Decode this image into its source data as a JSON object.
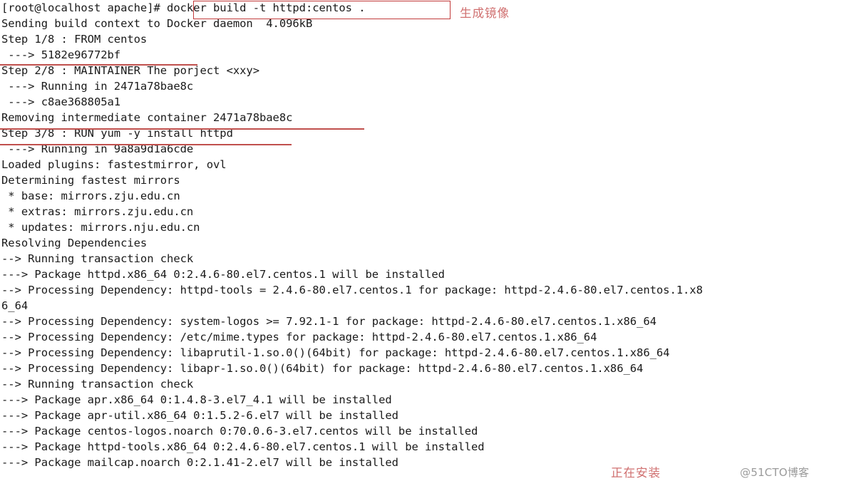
{
  "terminal": {
    "shell_prompt": "[root@localhost apache]# ",
    "typed_command": "docker build -t httpd:centos .",
    "lines": [
      "[root@localhost apache]# docker build -t httpd:centos .",
      "Sending build context to Docker daemon  4.096kB",
      "Step 1/8 : FROM centos",
      " ---> 5182e96772bf",
      "Step 2/8 : MAINTAINER The porject <xxy>",
      " ---> Running in 2471a78bae8c",
      " ---> c8ae368805a1",
      "Removing intermediate container 2471a78bae8c",
      "Step 3/8 : RUN yum -y install httpd",
      " ---> Running in 9a8a9d1a6cde",
      "Loaded plugins: fastestmirror, ovl",
      "Determining fastest mirrors",
      " * base: mirrors.zju.edu.cn",
      " * extras: mirrors.zju.edu.cn",
      " * updates: mirrors.nju.edu.cn",
      "Resolving Dependencies",
      "--> Running transaction check",
      "---> Package httpd.x86_64 0:2.4.6-80.el7.centos.1 will be installed",
      "--> Processing Dependency: httpd-tools = 2.4.6-80.el7.centos.1 for package: httpd-2.4.6-80.el7.centos.1.x8",
      "6_64",
      "--> Processing Dependency: system-logos >= 7.92.1-1 for package: httpd-2.4.6-80.el7.centos.1.x86_64",
      "--> Processing Dependency: /etc/mime.types for package: httpd-2.4.6-80.el7.centos.1.x86_64",
      "--> Processing Dependency: libaprutil-1.so.0()(64bit) for package: httpd-2.4.6-80.el7.centos.1.x86_64",
      "--> Processing Dependency: libapr-1.so.0()(64bit) for package: httpd-2.4.6-80.el7.centos.1.x86_64",
      "--> Running transaction check",
      "---> Package apr.x86_64 0:1.4.8-3.el7_4.1 will be installed",
      "---> Package apr-util.x86_64 0:1.5.2-6.el7 will be installed",
      "---> Package centos-logos.noarch 0:70.0.6-3.el7.centos will be installed",
      "---> Package httpd-tools.x86_64 0:2.4.6-80.el7.centos.1 will be installed",
      "---> Package mailcap.noarch 0:2.1.41-2.el7 will be installed"
    ]
  },
  "annotations": {
    "top_label": "生成镜像",
    "bottom_label": "正在安装",
    "color": "#d07070"
  },
  "watermark": {
    "text": "@51CTO博客"
  },
  "colors": {
    "background": "#ffffff",
    "text": "#1a1a1a",
    "highlight_red": "#c23b3b",
    "underline_red": "#c0504d",
    "annotation_red": "#d07070",
    "watermark_gray": "#9a9a9a"
  }
}
